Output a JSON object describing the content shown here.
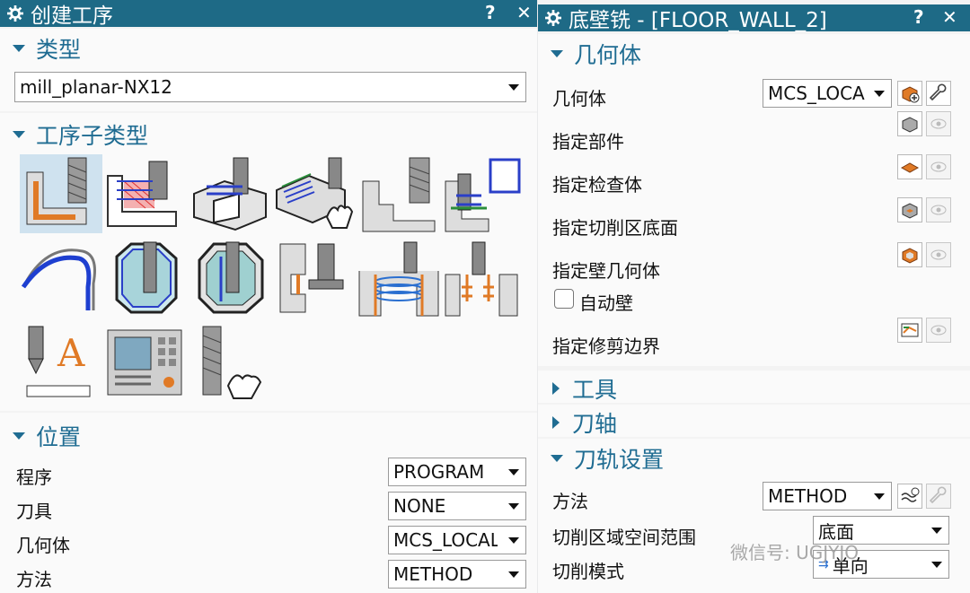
{
  "left_dialog": {
    "title": "创建工序",
    "help": "?",
    "close": "✕",
    "type_section": {
      "heading": "类型",
      "value": "mill_planar-NX12"
    },
    "subtype_section": {
      "heading": "工序子类型",
      "icons": [
        "floor-wall-icon",
        "floor-wall-ipw-icon",
        "zlevel-cavity-icon",
        "manual-face-icon",
        "zlevel-profile-icon",
        "groove-mill-icon",
        "hole-chamfer-icon",
        "planar-mill-icon",
        "cavity-mill-icon",
        "slot-mill-icon",
        "thread-mill-icon",
        "hole-mill-icon",
        "planar-text-icon",
        "mill-control-icon",
        "mill-user-icon"
      ]
    },
    "location_section": {
      "heading": "位置",
      "rows": [
        {
          "label": "程序",
          "value": "PROGRAM"
        },
        {
          "label": "刀具",
          "value": "NONE"
        },
        {
          "label": "几何体",
          "value": "MCS_LOCAL"
        },
        {
          "label": "方法",
          "value": "METHOD"
        }
      ]
    }
  },
  "right_dialog": {
    "title": "底壁铣 - [FLOOR_WALL_2]",
    "help": "?",
    "close": "✕",
    "geometry_section": {
      "heading": "几何体",
      "geometry_label": "几何体",
      "geometry_value": "MCS_LOCA",
      "rows": [
        "指定部件",
        "指定检查体",
        "指定切削区底面",
        "指定壁几何体"
      ],
      "auto_wall": "自动壁",
      "trim_boundary": "指定修剪边界"
    },
    "tool_section": {
      "heading": "工具"
    },
    "axis_section": {
      "heading": "刀轴"
    },
    "path_section": {
      "heading": "刀轨设置",
      "method_label": "方法",
      "method_value": "METHOD",
      "cut_area_label": "切削区域空间范围",
      "cut_area_value": "底面",
      "cut_pattern_label": "切削模式",
      "cut_pattern_value": "单向"
    }
  },
  "watermark": "微信号: UGJYJO",
  "colors": {
    "titlebar": "#1e6a86",
    "accent": "#1f6c92",
    "selected_tile": "#cfe2ef",
    "orange": "#e07a26"
  }
}
